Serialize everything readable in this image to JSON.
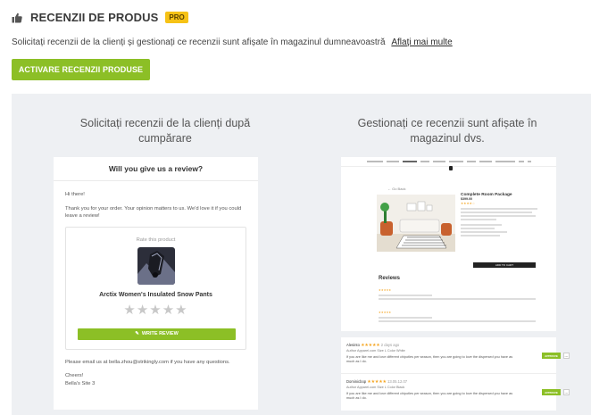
{
  "header": {
    "icon": "thumbs-up-icon",
    "title": "RECENZII DE PRODUS",
    "badge": "PRO"
  },
  "description": {
    "text": "Solicitați recenzii de la clienți și gestionați ce recenzii sunt afișate în magazinul dumneavoastră",
    "link": "Aflați mai multe"
  },
  "activate_button": "ACTIVARE RECENZII PRODUSE",
  "left_column": {
    "title": "Solicitați recenzii de la clienți după cumpărare",
    "email": {
      "heading": "Will you give us a review?",
      "greeting": "Hi there!",
      "intro": "Thank you for your order. Your opinion matters to us. We'd love it if you could leave a review!",
      "card": {
        "rate_label": "Rate this product",
        "product_name": "Arctix Women's Insulated Snow Pants",
        "stars": "★★★★★",
        "button": "WRITE REVIEW"
      },
      "questions": "Please email us at bella.zhou@strikingly.com if you have any questions.",
      "sign_off": "Cheers!",
      "signature": "Bella's Site 3"
    }
  },
  "right_column": {
    "title": "Gestionați ce recenzii sunt afișate în magazinul dvs.",
    "store": {
      "back_link": "← Go Back",
      "product_title": "Complete Room Package",
      "price": "$399.00",
      "add_to_cart": "ADD TO CART",
      "reviews_heading": "Reviews"
    },
    "reviews": [
      {
        "author": "Alesinto",
        "stars": "★★★★★",
        "date": "2 days ago",
        "meta": "Author Apparel.com   Size L   Color White",
        "text": "If you are like me and love different chipotles per season, then you are going to love the dispersed you have as much as I do.",
        "approve": "APPROVE",
        "more": "..."
      },
      {
        "author": "Dominicbop",
        "stars": "★★★★★",
        "date": "13.05.12.07",
        "meta": "Author Apparel.com   Size L   Color Black",
        "text": "If you are like me and love different chipotles per season, then you are going to love the dispersed you have as much as I do.",
        "approve": "APPROVE",
        "more": "..."
      }
    ]
  },
  "colors": {
    "accent_green": "#8cbf26",
    "pro_badge": "#f6c216",
    "panel_bg": "#eef0f3",
    "star": "#f5a623"
  }
}
